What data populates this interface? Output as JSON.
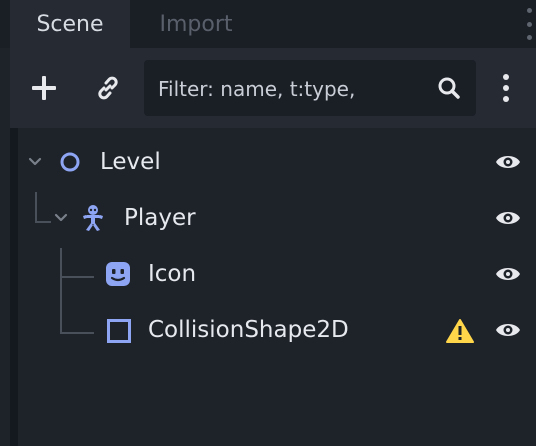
{
  "tabs": [
    {
      "label": "Scene",
      "active": true
    },
    {
      "label": "Import",
      "active": false
    }
  ],
  "toolbar": {
    "filter_placeholder": "Filter: name, t:type,",
    "icons": [
      "plus-icon",
      "link-icon",
      "search-icon",
      "kebab-menu-icon"
    ]
  },
  "tree": {
    "nodes": [
      {
        "label": "Level",
        "icon": "node2d-circle-icon",
        "expanded": true,
        "depth": 0,
        "visible": true
      },
      {
        "label": "Player",
        "icon": "character-body-icon",
        "expanded": true,
        "depth": 1,
        "visible": true
      },
      {
        "label": "Icon",
        "icon": "sprite-icon",
        "depth": 2,
        "visible": true
      },
      {
        "label": "CollisionShape2D",
        "icon": "collision-shape-icon",
        "depth": 2,
        "visible": true,
        "warning": true
      }
    ]
  },
  "colors": {
    "background": "#14181f",
    "panel": "#252a33",
    "tree_bg": "#1e2229",
    "node_icon_blue": "#8da5f3",
    "warning_yellow": "#ffd54a",
    "text": "#e6e9ee"
  }
}
